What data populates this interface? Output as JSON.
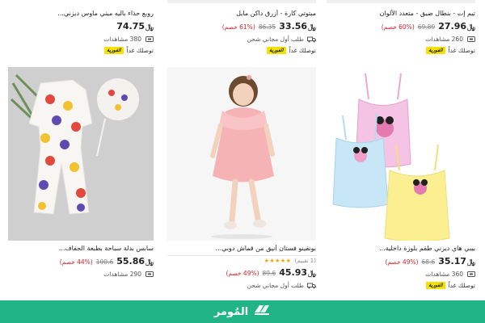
{
  "products": [
    {
      "id_key": "p1",
      "title": "تيم إت - بنطال ضيق - متعدد الألوان",
      "price": "27.96",
      "old_price": "69.89",
      "discount": "(60% خصم)",
      "views": "260 مشاهدات",
      "delivery": "توصلك غداً"
    },
    {
      "id_key": "p2",
      "title": "ميتوتي كارة - أزرق داكن مايل",
      "price": "33.56",
      "old_price": "86.35",
      "discount": "(61% خصم)",
      "shipping": "طلب أول مجاني شحن",
      "delivery": "توصلك غداً"
    },
    {
      "id_key": "p3",
      "title": "روبع حذاء باليه ميني ماوس ديزني...",
      "price": "74.75",
      "views": "380 مشاهدات",
      "delivery": "توصلك غداً"
    },
    {
      "id_key": "p4",
      "title": "بيبي هاي ديزني طقم بلوزة داخلية...",
      "price": "35.17",
      "old_price": "68.6",
      "discount": "(49% خصم)",
      "views": "360 مشاهدات",
      "delivery": "توصلك غداً"
    },
    {
      "id_key": "p5",
      "title": "بونفينو فستان أنيق من قماش دوبي...",
      "rating_count": "(1 تقييم)",
      "stars": "★★★★★",
      "price": "45.93",
      "old_price": "89.6",
      "discount": "(49% خصم)",
      "shipping": "طلب أول مجاني شحن"
    },
    {
      "id_key": "p6",
      "title": "سابس بدلة سباحة بطبعة الجفاف...",
      "price": "55.86",
      "old_price": "100.6",
      "discount": "(44% خصم)",
      "views": "290 مشاهدات"
    }
  ],
  "express_label": "الفورية",
  "footer": {
    "brand": "المُومر"
  },
  "colors": {
    "accent": "#21b585",
    "discount": "#d8232a",
    "express": "#f6e200",
    "star": "#f4a300"
  },
  "icons": {
    "views": "eye-icon",
    "shipping": "truck-icon",
    "express": "express-badge-icon",
    "currency": "riyal-icon"
  }
}
